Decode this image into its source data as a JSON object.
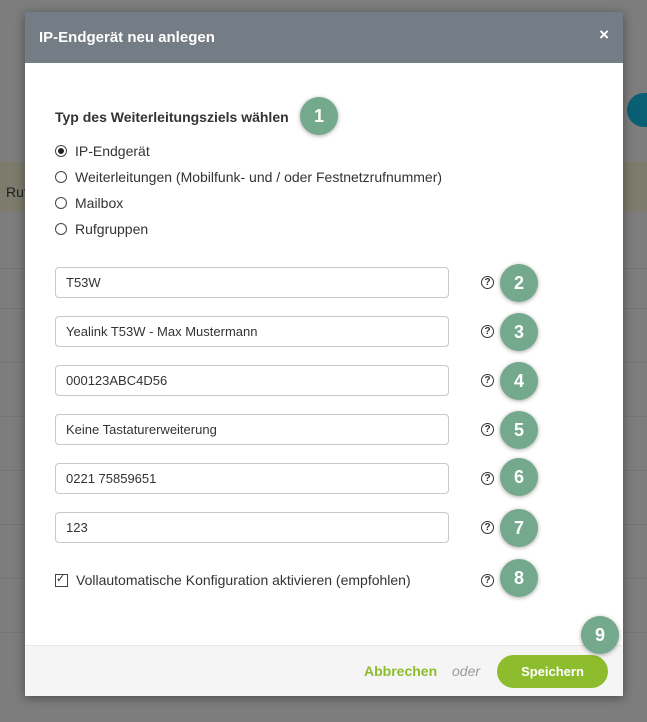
{
  "background": {
    "fragment_text": "Ruf"
  },
  "modal": {
    "title": "IP-Endgerät neu anlegen",
    "close_label": "×",
    "section_title": "Typ des Weiterleitungsziels wählen",
    "radio_options": [
      {
        "label": "IP-Endgerät",
        "checked": true
      },
      {
        "label": "Weiterleitungen (Mobilfunk- und / oder Festnetzrufnummer)",
        "checked": false
      },
      {
        "label": "Mailbox",
        "checked": false
      },
      {
        "label": "Rufgruppen",
        "checked": false
      }
    ],
    "fields": [
      {
        "value": "T53W"
      },
      {
        "value": "Yealink T53W - Max Mustermann"
      },
      {
        "value": "000123ABC4D56"
      },
      {
        "value": "Keine Tastaturerweiterung"
      },
      {
        "value": "0221 75859651"
      },
      {
        "value": "123"
      }
    ],
    "help_icon_glyph": "?",
    "auto_config": {
      "label": "Vollautomatische Konfiguration aktivieren (empfohlen)",
      "checked": true
    },
    "footer": {
      "cancel_label": "Abbrechen",
      "or_label": "oder",
      "save_label": "Speichern"
    }
  },
  "step_markers": [
    "1",
    "2",
    "3",
    "4",
    "5",
    "6",
    "7",
    "8",
    "9"
  ],
  "colors": {
    "header": "#747c86",
    "accent_green": "#8dbd2c",
    "marker": "#74a98e"
  }
}
